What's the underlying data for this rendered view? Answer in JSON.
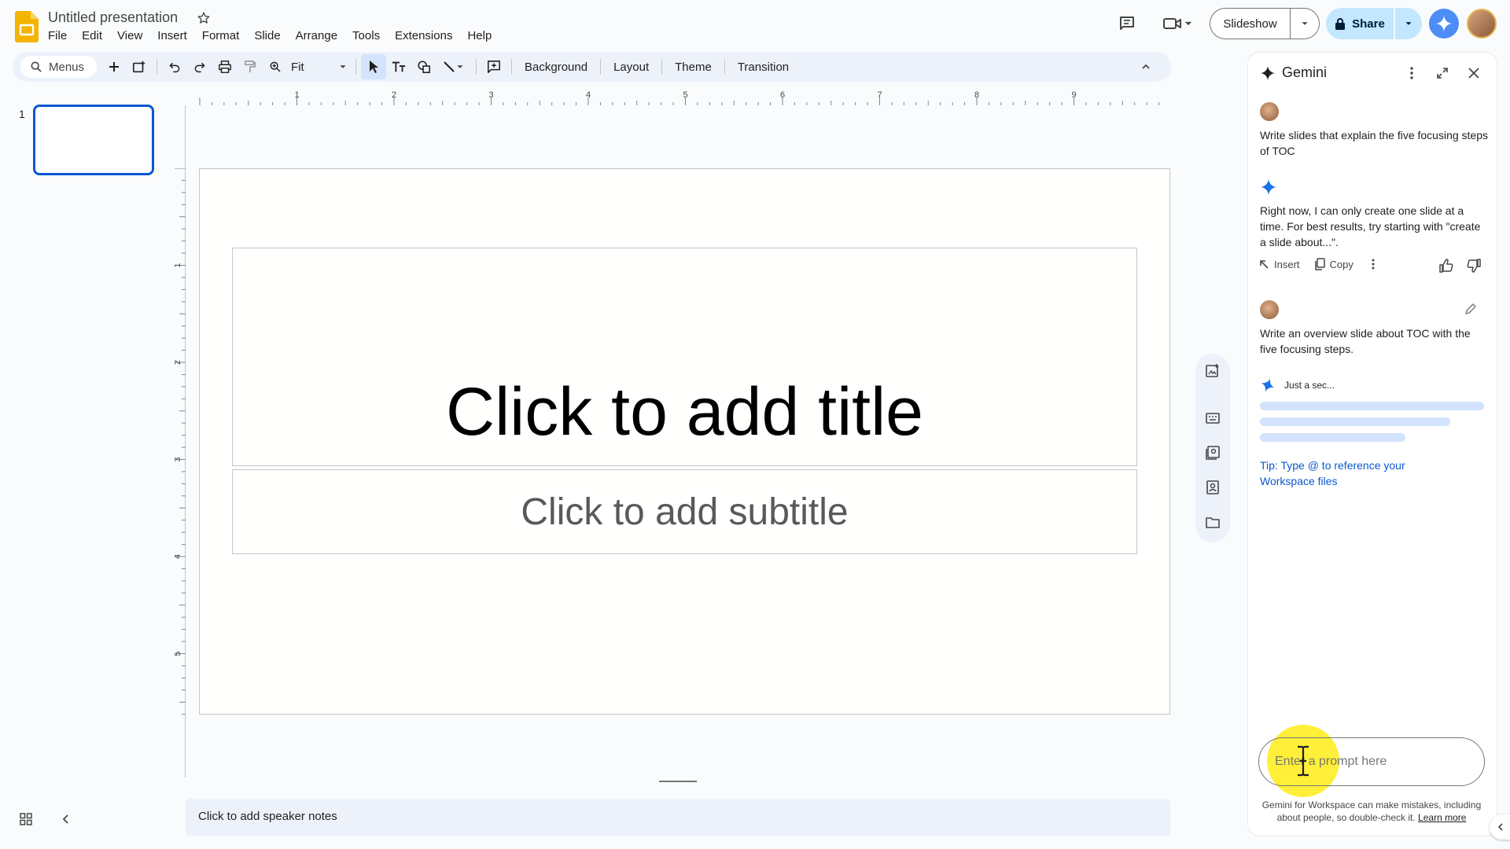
{
  "app": {
    "doc_title": "Untitled presentation",
    "menus": [
      "File",
      "Edit",
      "View",
      "Insert",
      "Format",
      "Slide",
      "Arrange",
      "Tools",
      "Extensions",
      "Help"
    ],
    "slideshow_label": "Slideshow",
    "share_label": "Share",
    "brand_color": "#f4b400",
    "accent_color": "#0b57d0"
  },
  "toolbar": {
    "search_label": "Menus",
    "zoom_label": "Fit",
    "background_label": "Background",
    "layout_label": "Layout",
    "theme_label": "Theme",
    "transition_label": "Transition"
  },
  "filmstrip": {
    "slide_number": "1"
  },
  "rulers": {
    "horizontal": [
      "1",
      "2",
      "3",
      "4",
      "5",
      "6",
      "7",
      "8",
      "9"
    ],
    "vertical": [
      "1",
      "2",
      "3",
      "4",
      "5"
    ]
  },
  "slide": {
    "title_placeholder": "Click to add title",
    "subtitle_placeholder": "Click to add subtitle"
  },
  "notes": {
    "placeholder": "Click to add speaker notes"
  },
  "gemini": {
    "title": "Gemini",
    "messages": [
      {
        "role": "user",
        "text": "Write slides that explain the five focusing steps of TOC"
      },
      {
        "role": "assistant",
        "text": "Right now, I can only create one slide at a time. For best results, try starting with \"create a slide about...\"."
      },
      {
        "role": "user",
        "text": "Write an overview slide about TOC with the five focusing steps."
      }
    ],
    "insert_label": "Insert",
    "copy_label": "Copy",
    "loading_text": "Just a sec...",
    "tip_text": "Tip: Type @ to reference your Workspace files",
    "prompt_placeholder": "Enter a prompt here",
    "disclaimer_text": "Gemini for Workspace can make mistakes, including about people, so double-check it.",
    "learn_more_label": "Learn more"
  }
}
